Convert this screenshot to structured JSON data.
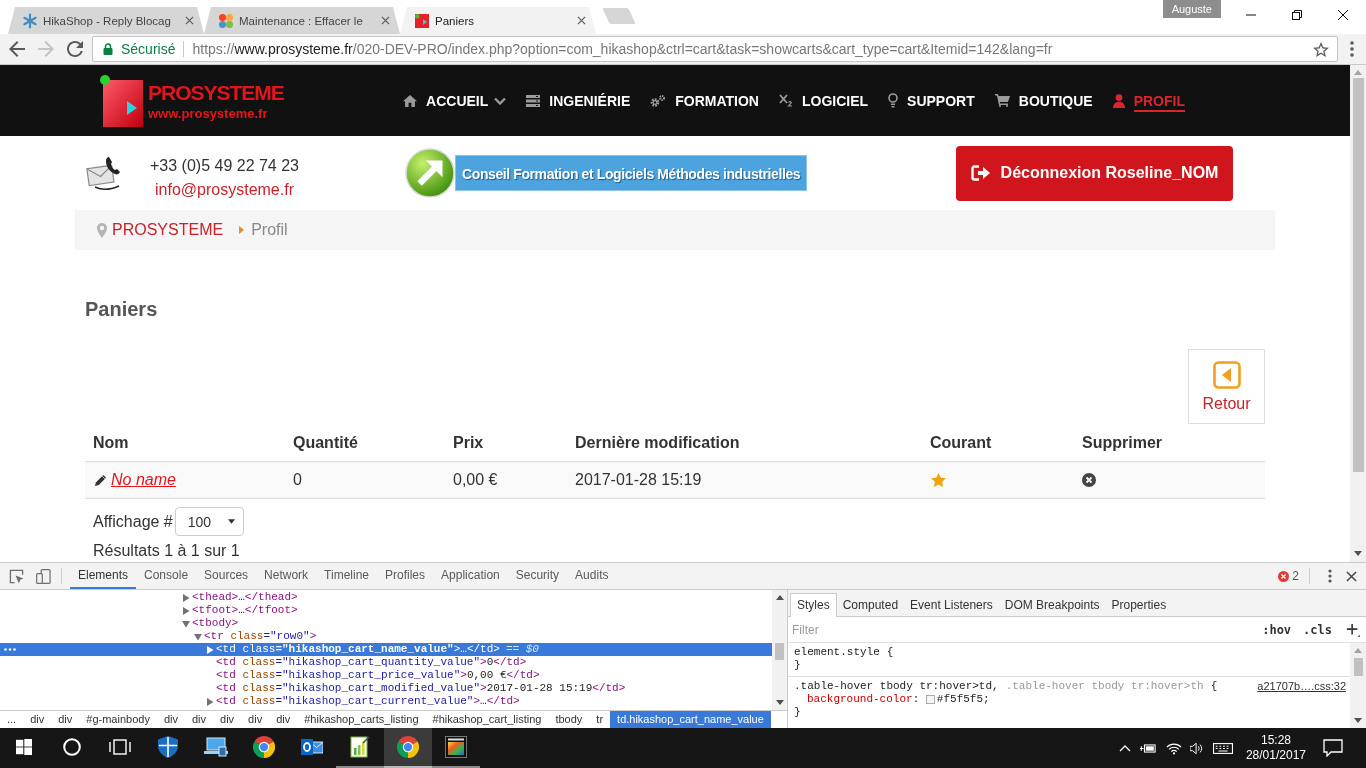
{
  "browser": {
    "tabs": [
      {
        "kind": "asterisk",
        "title": "HikaShop - Reply Blocag",
        "selected": false
      },
      {
        "kind": "petals",
        "title": "Maintenance : Effacer le",
        "selected": false
      },
      {
        "kind": "square",
        "title": "Paniers",
        "selected": true
      }
    ],
    "profile": "Auguste",
    "back_enabled": true,
    "forward_enabled": false,
    "address_bar": {
      "security": "Sécurisé",
      "scheme": "https://",
      "host": "www.prosysteme.fr",
      "path": "/020-DEV-PRO/index.php?option=com_hikashop&ctrl=cart&task=showcarts&cart_type=cart&Itemid=142&lang=fr"
    }
  },
  "site": {
    "logo": {
      "name": "PROSYSTEME",
      "url": "www.prosysteme.fr"
    },
    "nav": [
      {
        "kind": "home",
        "label": "ACCUEIL",
        "dropdown": true,
        "selected": false
      },
      {
        "kind": "server",
        "label": "INGENIÉRIE",
        "dropdown": false,
        "selected": false
      },
      {
        "kind": "gears",
        "label": "FORMATION",
        "dropdown": false,
        "selected": false
      },
      {
        "kind": "subscript",
        "label": "LOGICIEL",
        "dropdown": false,
        "selected": false
      },
      {
        "kind": "bulb",
        "label": "SUPPORT",
        "dropdown": false,
        "selected": false
      },
      {
        "kind": "cart",
        "label": "BOUTIQUE",
        "dropdown": false,
        "selected": false
      },
      {
        "kind": "user",
        "label": "PROFIL",
        "dropdown": false,
        "selected": true
      }
    ],
    "contact": {
      "phone": "+33 (0)5 49 22 74 23",
      "email": "info@prosysteme.fr"
    },
    "banner": "Conseil Formation et Logiciels Méthodes industrielles",
    "logout": "Déconnexion Roseline_NOM",
    "breadcrumb": [
      {
        "label": "PROSYSTEME",
        "current": false
      },
      {
        "label": "Profil",
        "current": true
      }
    ]
  },
  "page": {
    "title": "Paniers",
    "back_button": "Retour",
    "table": {
      "columns": [
        "Nom",
        "Quantité",
        "Prix",
        "Dernière modification",
        "Courant",
        "Supprimer"
      ],
      "rows": [
        {
          "name": "No name",
          "quantity": "0",
          "price": "0,00 €",
          "modified": "2017-01-28 15:19",
          "current": true
        }
      ]
    },
    "per_page": {
      "label": "Affichage #",
      "value": "100"
    },
    "results": "Résultats 1 à 1 sur 1"
  },
  "devtools": {
    "tabs": [
      {
        "label": "Elements",
        "selected": true
      },
      {
        "label": "Console",
        "selected": false
      },
      {
        "label": "Sources",
        "selected": false
      },
      {
        "label": "Network",
        "selected": false
      },
      {
        "label": "Timeline",
        "selected": false
      },
      {
        "label": "Profiles",
        "selected": false
      },
      {
        "label": "Application",
        "selected": false
      },
      {
        "label": "Security",
        "selected": false
      },
      {
        "label": "Audits",
        "selected": false
      }
    ],
    "error_count": "2",
    "dom_tree": [
      {
        "tokens": [
          {
            "kind": "tag",
            "text": "<thead>"
          }
        ],
        "tail": [
          {
            "kind": "text",
            "text": "…"
          },
          {
            "kind": "tag",
            "text": "</thead>"
          }
        ],
        "expandable": true,
        "expanded": false,
        "selected": false
      },
      {
        "tokens": [
          {
            "kind": "tag",
            "text": "<tfoot>"
          }
        ],
        "tail": [
          {
            "kind": "text",
            "text": "…"
          },
          {
            "kind": "tag",
            "text": "</tfoot>"
          }
        ],
        "expandable": true,
        "expanded": false,
        "selected": false
      },
      {
        "tokens": [
          {
            "kind": "tag",
            "text": "<tbody>"
          }
        ],
        "expandable": true,
        "expanded": true,
        "selected": false,
        "children": [
          {
            "tokens": [
              {
                "kind": "tag",
                "text": "<tr"
              },
              {
                "kind": "attr",
                "text": " class"
              },
              {
                "kind": "value",
                "text": "=\"row0\""
              },
              {
                "kind": "tag",
                "text": ">"
              }
            ],
            "expandable": true,
            "expanded": true,
            "selected": false,
            "children": [
              {
                "tokens": [
                  {
                    "kind": "tag",
                    "text": "<td"
                  },
                  {
                    "kind": "attr",
                    "text": " class"
                  },
                  {
                    "kind": "value",
                    "text": "=\"hikashop_cart_name_value\""
                  },
                  {
                    "kind": "tag",
                    "text": ">"
                  }
                ],
                "tail": [
                  {
                    "kind": "text",
                    "text": "…"
                  },
                  {
                    "kind": "tag",
                    "text": "</td>"
                  }
                ],
                "expandable": true,
                "expanded": false,
                "selected": true,
                "console_ref": "== $0"
              },
              {
                "tokens": [
                  {
                    "kind": "tag",
                    "text": "<td"
                  },
                  {
                    "kind": "attr",
                    "text": " class"
                  },
                  {
                    "kind": "value",
                    "text": "=\"hikashop_cart_quantity_value\""
                  },
                  {
                    "kind": "tag",
                    "text": ">"
                  },
                  {
                    "kind": "text",
                    "text": "0"
                  },
                  {
                    "kind": "tag",
                    "text": "</td>"
                  }
                ],
                "expandable": false,
                "expanded": false,
                "selected": false
              },
              {
                "tokens": [
                  {
                    "kind": "tag",
                    "text": "<td"
                  },
                  {
                    "kind": "attr",
                    "text": " class"
                  },
                  {
                    "kind": "value",
                    "text": "=\"hikashop_cart_price_value\""
                  },
                  {
                    "kind": "tag",
                    "text": ">"
                  },
                  {
                    "kind": "text",
                    "text": "0,00 €"
                  },
                  {
                    "kind": "tag",
                    "text": "</td>"
                  }
                ],
                "expandable": false,
                "expanded": false,
                "selected": false
              },
              {
                "tokens": [
                  {
                    "kind": "tag",
                    "text": "<td"
                  },
                  {
                    "kind": "attr",
                    "text": " class"
                  },
                  {
                    "kind": "value",
                    "text": "=\"hikashop_cart_modified_value\""
                  },
                  {
                    "kind": "tag",
                    "text": ">"
                  },
                  {
                    "kind": "text",
                    "text": "2017-01-28 15:19"
                  },
                  {
                    "kind": "tag",
                    "text": "</td>"
                  }
                ],
                "expandable": false,
                "expanded": false,
                "selected": false
              },
              {
                "tokens": [
                  {
                    "kind": "tag",
                    "text": "<td"
                  },
                  {
                    "kind": "attr",
                    "text": " class"
                  },
                  {
                    "kind": "value",
                    "text": "=\"hikashop_cart_current_value\""
                  },
                  {
                    "kind": "tag",
                    "text": ">"
                  }
                ],
                "tail": [
                  {
                    "kind": "text",
                    "text": "…"
                  },
                  {
                    "kind": "tag",
                    "text": "</td>"
                  }
                ],
                "expandable": true,
                "expanded": false,
                "selected": false
              }
            ]
          }
        ]
      }
    ],
    "dom_path": [
      {
        "label": "...",
        "selected": false
      },
      {
        "label": "div",
        "selected": false
      },
      {
        "label": "div",
        "selected": false
      },
      {
        "label": "#g-mainbody",
        "selected": false
      },
      {
        "label": "div",
        "selected": false
      },
      {
        "label": "div",
        "selected": false
      },
      {
        "label": "div",
        "selected": false
      },
      {
        "label": "div",
        "selected": false
      },
      {
        "label": "div",
        "selected": false
      },
      {
        "label": "#hikashop_carts_listing",
        "selected": false
      },
      {
        "label": "#hikashop_cart_listing",
        "selected": false
      },
      {
        "label": "tbody",
        "selected": false
      },
      {
        "label": "tr",
        "selected": false
      },
      {
        "label": "td.hikashop_cart_name_value",
        "selected": true
      }
    ],
    "sidebar_tabs": [
      {
        "label": "Styles",
        "selected": true
      },
      {
        "label": "Computed",
        "selected": false
      },
      {
        "label": "Event Listeners",
        "selected": false
      },
      {
        "label": "DOM Breakpoints",
        "selected": false
      },
      {
        "label": "Properties",
        "selected": false
      }
    ],
    "filter": {
      "placeholder": "Filter"
    },
    "filter_buttons": [
      ":hov",
      ".cls"
    ],
    "rules": [
      {
        "selectors": [
          {
            "text": "element.style",
            "matched": true
          }
        ],
        "open": "{",
        "close": "}"
      },
      {
        "selectors": [
          {
            "text": ".table-hover tbody tr:hover>td,",
            "matched": true
          },
          {
            "text": ".table-hover tbody tr:hover>th",
            "matched": false
          }
        ],
        "open": "{",
        "source": "a21707b….css:32",
        "declarations": [
          {
            "property": "background-color",
            "separator": ": ",
            "value": "#f5f5f5;",
            "color": "#f5f5f5"
          }
        ],
        "close": "}"
      }
    ]
  },
  "taskbar": {
    "buttons": [
      {
        "kind": "start",
        "active": false,
        "running": false
      },
      {
        "kind": "search",
        "active": false,
        "running": false
      },
      {
        "kind": "task-view",
        "active": false,
        "running": false
      },
      {
        "kind": "shield",
        "active": false,
        "running": false
      },
      {
        "kind": "computer",
        "active": false,
        "running": false
      },
      {
        "kind": "browser",
        "active": false,
        "running": false
      },
      {
        "kind": "mail",
        "active": false,
        "running": false
      },
      {
        "kind": "chart",
        "active": false,
        "running": true
      },
      {
        "kind": "browser",
        "active": true,
        "running": true
      },
      {
        "kind": "studio",
        "active": false,
        "running": true
      }
    ],
    "time": "15:28",
    "date": "28/01/2017"
  }
}
